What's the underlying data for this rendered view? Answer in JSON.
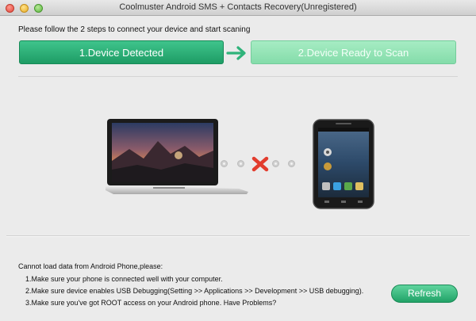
{
  "window": {
    "title": "Coolmuster Android SMS + Contacts Recovery(Unregistered)"
  },
  "main": {
    "instruction": "Please follow the 2 steps to connect your device and start scaning",
    "steps": [
      {
        "label": "1.Device Detected"
      },
      {
        "label": "2.Device Ready to Scan"
      }
    ]
  },
  "help": {
    "heading": "Cannot load data from Android Phone,please:",
    "lines": [
      "1.Make sure your phone is connected well with your computer.",
      "2.Make sure device enables USB Debugging(Setting >> Applications >> Development >> USB debugging).",
      "3.Make sure you've got ROOT access on your Android phone. Have Problems?"
    ]
  },
  "actions": {
    "refresh_label": "Refresh"
  },
  "colors": {
    "step_active": "#2fb37a",
    "step_inactive": "#96e4b7",
    "arrow": "#2fb37a",
    "error_x": "#e23d2e"
  },
  "icons": {
    "laptop": "laptop-icon",
    "phone": "android-phone-icon",
    "disconnected": "close-x-icon",
    "arrow": "arrow-right-icon"
  }
}
